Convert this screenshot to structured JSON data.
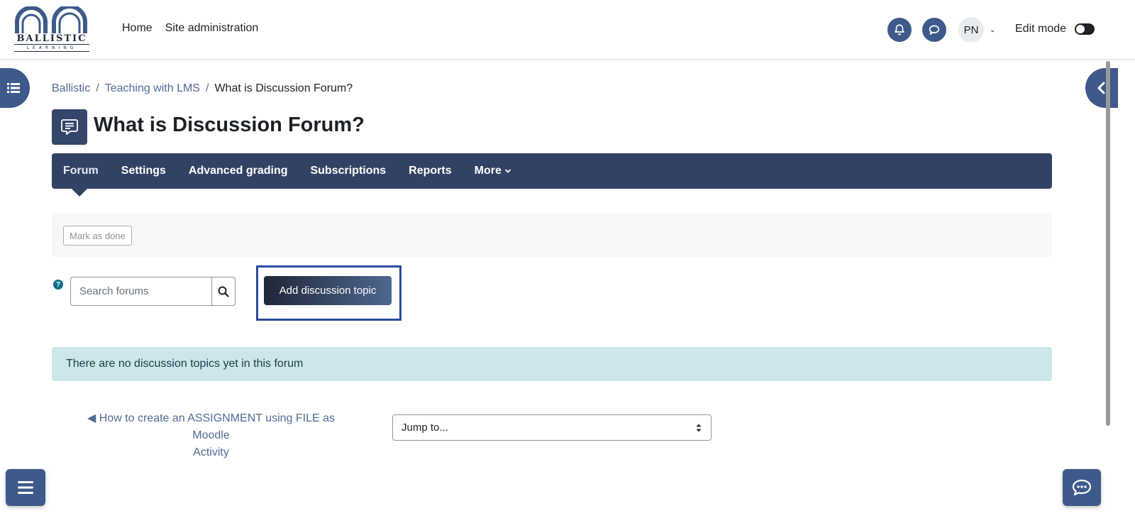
{
  "logo": {
    "name": "BALLISTIC",
    "subtitle": "LEARNING"
  },
  "primary_nav": {
    "home": "Home",
    "site_admin": "Site administration"
  },
  "user": {
    "initials": "PN"
  },
  "edit_mode": {
    "label": "Edit mode",
    "on": false
  },
  "breadcrumb": {
    "items": [
      "Ballistic",
      "Teaching with LMS"
    ],
    "current": "What is Discussion Forum?",
    "separator": "/"
  },
  "page": {
    "title": "What is Discussion Forum?"
  },
  "secondary_nav": {
    "active": "Forum",
    "items": [
      "Forum",
      "Settings",
      "Advanced grading",
      "Subscriptions",
      "Reports",
      "More"
    ]
  },
  "completion": {
    "mark_done": "Mark as done"
  },
  "search": {
    "placeholder": "Search forums",
    "value": ""
  },
  "actions": {
    "add_topic": "Add discussion topic"
  },
  "alert": {
    "message": "There are no discussion topics yet in this forum"
  },
  "activity_nav": {
    "prev_arrow": "◀",
    "prev_line1": "How to create an ASSIGNMENT using FILE as Moodle",
    "prev_line2": "Activity",
    "jump_to": "Jump to..."
  },
  "colors": {
    "brand": "#3d5a8a",
    "nav_bg": "#324264",
    "alert_bg": "#cce6ea",
    "highlight": "#2a4ca0"
  }
}
